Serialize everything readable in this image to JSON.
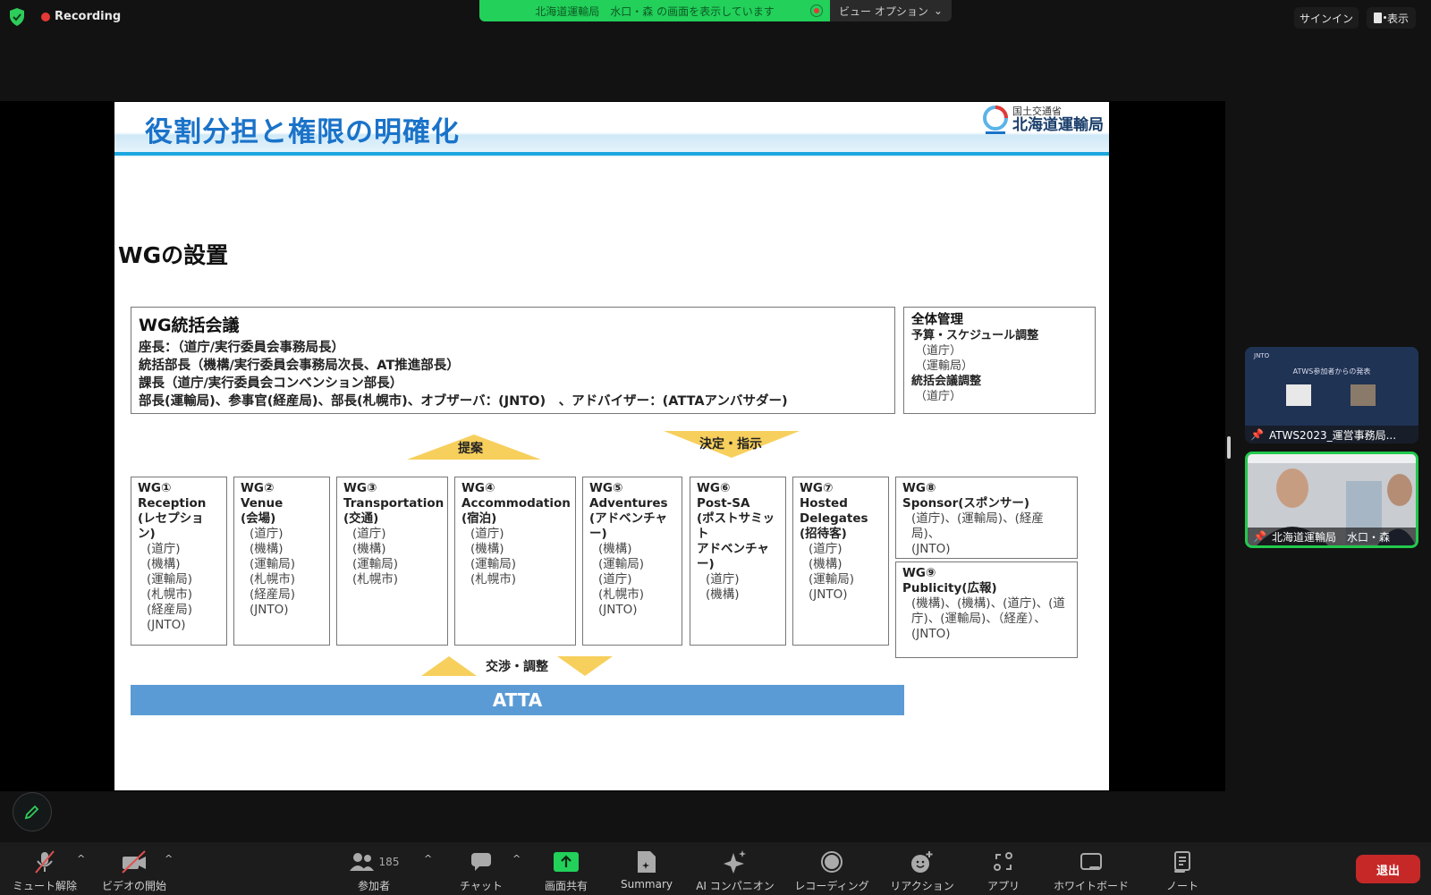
{
  "topbar": {
    "recording_label": "Recording",
    "share_banner": "北海道運輸局　水口・森 の画面を表示しています",
    "view_options": "ビュー オプション",
    "sign_in": "サインイン",
    "display": "表示"
  },
  "slide": {
    "title": "役割分担と権限の明確化",
    "logo_top": "国土交通省",
    "logo_main": "北海道運輸局",
    "section_title": "WGの設置",
    "council": {
      "heading": "WG統括会議",
      "lines": [
        "座長：（道庁/実行委員会事務局長）",
        "統括部長（機構/実行委員会事務局次長、AT推進部長）",
        "課長（道庁/実行委員会コンベンション部長）",
        "部長(運輸局)、参事官(経産局)、部長(札幌市)、オブザーバ：(JNTO)　、アドバイザー：(ATTAアンバサダー)"
      ]
    },
    "management": {
      "heading": "全体管理",
      "sub1": "予算・スケジュール調整",
      "sub1_members": [
        "（道庁）",
        "（運輸局）"
      ],
      "sub2": "統括会議調整",
      "sub2_members": [
        "（道庁）"
      ]
    },
    "arrows": {
      "propose": "提案",
      "decide": "決定・指示",
      "negotiate": "交渉・調整"
    },
    "working_groups": [
      {
        "id": "WG①",
        "name_lines": [
          "Reception",
          "(レセプション)"
        ],
        "members": [
          "(道庁)",
          "(機構)",
          "(運輸局)",
          "(札幌市)",
          "(経産局)",
          "(JNTO)"
        ]
      },
      {
        "id": "WG②",
        "name_lines": [
          "Venue",
          "(会場)"
        ],
        "members": [
          "(道庁)",
          "(機構)",
          "(運輸局)",
          "(札幌市)",
          "(経産局)",
          "(JNTO)"
        ]
      },
      {
        "id": "WG③",
        "name_lines": [
          "Transportation",
          "(交通)"
        ],
        "members": [
          "(道庁)",
          "(機構)",
          "(運輸局)",
          "(札幌市)"
        ]
      },
      {
        "id": "WG④",
        "name_lines": [
          "Accommodation",
          "(宿泊)"
        ],
        "members": [
          "(道庁)",
          "(機構)",
          "(運輸局)",
          "(札幌市)"
        ]
      },
      {
        "id": "WG⑤",
        "name_lines": [
          "Adventures",
          "(アドベンチャー)"
        ],
        "members": [
          "(機構)",
          "(運輸局)",
          "(道庁)",
          "(札幌市)",
          "(JNTO)"
        ]
      },
      {
        "id": "WG⑥",
        "name_lines": [
          "Post-SA",
          "(ポストサミット",
          "アドベンチャー)"
        ],
        "members": [
          "(道庁)",
          "(機構)"
        ]
      },
      {
        "id": "WG⑦",
        "name_lines": [
          "Hosted",
          "Delegates",
          "(招待客)"
        ],
        "members": [
          "(道庁)",
          "(機構)",
          "(運輸局)",
          "(JNTO)"
        ]
      },
      {
        "id": "WG⑧",
        "name_lines": [
          "Sponsor(スポンサー)"
        ],
        "members": [
          "(道庁)、(運輸局)、(経産局)、",
          "(JNTO)"
        ]
      },
      {
        "id": "WG⑨",
        "name_lines": [
          "Publicity(広報)"
        ],
        "members": [
          "(機構)、(機構)、(道庁)、(道",
          "庁)、(運輸局)、（経産）、",
          "(JNTO)"
        ]
      }
    ],
    "atta": "ATTA"
  },
  "participants": [
    {
      "name": "ATWS2023_運営事務局...",
      "slide_title": "ATWS参加者からの発表",
      "logo": "JNTO"
    },
    {
      "name": "北海道運輸局　水口・森",
      "active_speaker": true
    }
  ],
  "toolbar": {
    "items": [
      {
        "label": "ミュート解除",
        "icon": "microphone-muted-icon"
      },
      {
        "label": "ビデオの開始",
        "icon": "video-off-icon"
      },
      {
        "label": "参加者",
        "icon": "participants-icon",
        "count": "185"
      },
      {
        "label": "チャット",
        "icon": "chat-icon"
      },
      {
        "label": "画面共有",
        "icon": "share-screen-icon"
      },
      {
        "label": "Summary",
        "icon": "summary-icon"
      },
      {
        "label": "AI コンパニオン",
        "icon": "ai-companion-icon"
      },
      {
        "label": "レコーディング",
        "icon": "record-icon"
      },
      {
        "label": "リアクション",
        "icon": "reaction-icon"
      },
      {
        "label": "アプリ",
        "icon": "apps-icon"
      },
      {
        "label": "ホワイトボード",
        "icon": "whiteboard-icon"
      },
      {
        "label": "ノート",
        "icon": "notes-icon"
      }
    ],
    "exit_label": "退出"
  },
  "colors": {
    "share_green": "#22d05a",
    "title_blue": "#1a73c9",
    "atta_blue": "#5b9bd5",
    "arrow_yellow": "#f7cf5c",
    "exit_red": "#c62828"
  }
}
